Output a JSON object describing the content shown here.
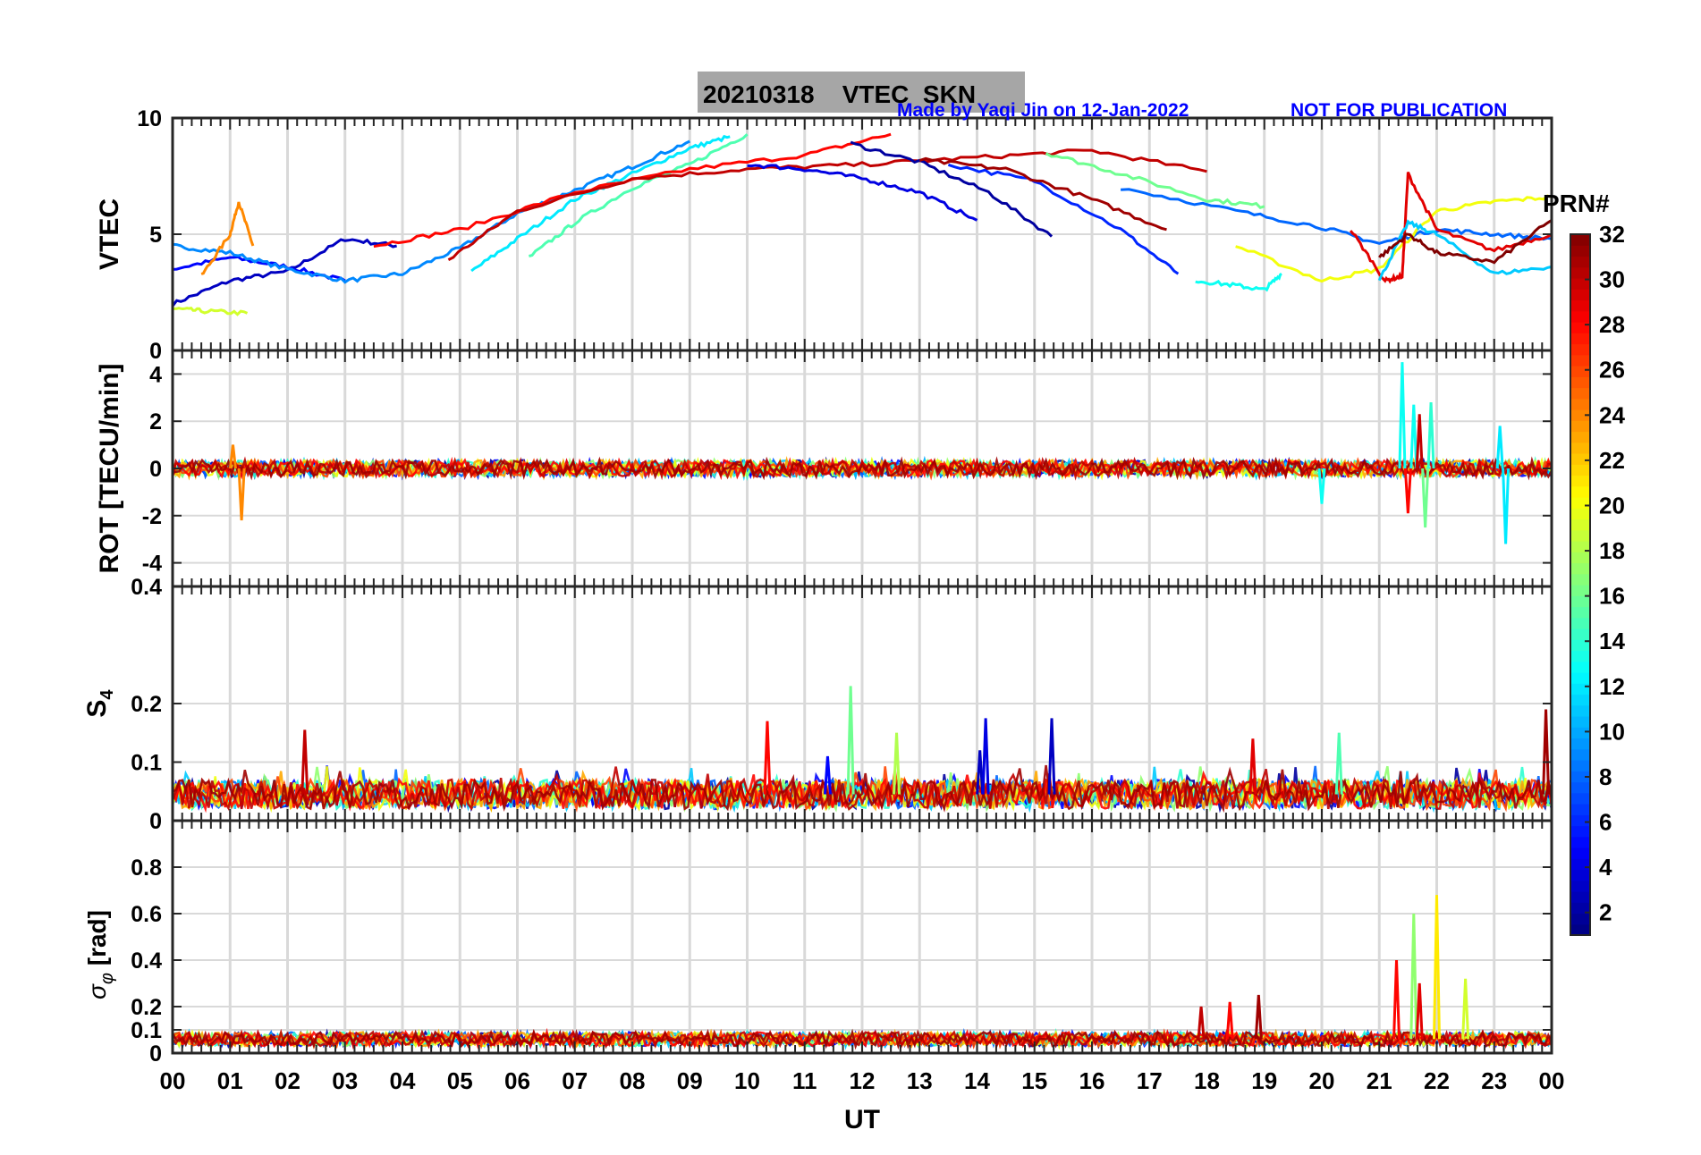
{
  "header": {
    "title": "20210318    VTEC  SKN",
    "credit": "Made by Yaqi Jin on 12-Jan-2022",
    "notice": "NOT FOR PUBLICATION"
  },
  "xaxis": {
    "label": "UT",
    "ticks": [
      "00",
      "01",
      "02",
      "03",
      "04",
      "05",
      "06",
      "07",
      "08",
      "09",
      "10",
      "11",
      "12",
      "13",
      "14",
      "15",
      "16",
      "17",
      "18",
      "19",
      "20",
      "21",
      "22",
      "23",
      "00"
    ],
    "range": [
      0,
      24
    ]
  },
  "colorbar": {
    "title": "PRN#",
    "range": [
      1,
      32
    ],
    "ticks": [
      2,
      4,
      6,
      8,
      10,
      12,
      14,
      16,
      18,
      20,
      22,
      24,
      26,
      28,
      30,
      32
    ],
    "colormap": "jet"
  },
  "chart_data": [
    {
      "type": "line",
      "panel": "vtec",
      "ylabel": "VTEC",
      "ylim": [
        0,
        10
      ],
      "yticks": [
        0,
        5,
        10
      ],
      "grid": true,
      "series": [
        {
          "prn": 3,
          "x": [
            0,
            1,
            2,
            3,
            3.9
          ],
          "y": [
            2.0,
            3.0,
            3.4,
            4.8,
            4.5
          ]
        },
        {
          "prn": 5,
          "x": [
            0,
            1,
            2,
            3
          ],
          "y": [
            3.5,
            4.0,
            3.6,
            3.0
          ]
        },
        {
          "prn": 9,
          "x": [
            0,
            1,
            2,
            3,
            4,
            5,
            6,
            7,
            8,
            9
          ],
          "y": [
            4.5,
            4.2,
            3.5,
            3.0,
            3.3,
            4.4,
            5.9,
            6.9,
            7.9,
            9.0
          ]
        },
        {
          "prn": 24,
          "x": [
            0.5,
            1.0,
            1.15,
            1.4
          ],
          "y": [
            3.2,
            5.0,
            6.4,
            4.5
          ]
        },
        {
          "prn": 19,
          "x": [
            0,
            0.5,
            1.3
          ],
          "y": [
            1.8,
            1.7,
            1.6
          ]
        },
        {
          "prn": 12,
          "x": [
            5.2,
            6.0,
            7.0,
            8.0,
            9.0,
            9.7
          ],
          "y": [
            3.4,
            4.8,
            6.5,
            7.6,
            8.7,
            9.2
          ]
        },
        {
          "prn": 15,
          "x": [
            6.2,
            7.0,
            8.0,
            9.0,
            10.0
          ],
          "y": [
            4.0,
            5.5,
            7.0,
            8.0,
            9.3
          ]
        },
        {
          "prn": 28,
          "x": [
            3.5,
            5,
            7,
            9,
            11,
            12.5
          ],
          "y": [
            4.5,
            5.2,
            6.8,
            7.8,
            8.4,
            9.3
          ]
        },
        {
          "prn": 30,
          "x": [
            4.8,
            6,
            8,
            10,
            12,
            14,
            16,
            18
          ],
          "y": [
            3.9,
            6.0,
            7.4,
            7.8,
            8.0,
            8.3,
            8.6,
            7.7
          ]
        },
        {
          "prn": 4,
          "x": [
            10,
            11,
            12,
            13,
            14.0
          ],
          "y": [
            8.0,
            7.8,
            7.4,
            6.8,
            5.6
          ]
        },
        {
          "prn": 2,
          "x": [
            11.8,
            13,
            14.2,
            15.3
          ],
          "y": [
            8.9,
            8.1,
            6.8,
            4.9
          ]
        },
        {
          "prn": 6,
          "x": [
            13.5,
            15,
            16.5,
            17.5
          ],
          "y": [
            8.0,
            7.3,
            5.2,
            3.3
          ]
        },
        {
          "prn": 31,
          "x": [
            13.0,
            14.5,
            16,
            17.3
          ],
          "y": [
            8.2,
            7.8,
            6.5,
            5.2
          ]
        },
        {
          "prn": 16,
          "x": [
            15.2,
            16.5,
            18,
            19.0
          ],
          "y": [
            8.5,
            7.6,
            6.5,
            6.2
          ]
        },
        {
          "prn": 13,
          "x": [
            17.8,
            18.5,
            19.0,
            19.3
          ],
          "y": [
            3.0,
            2.8,
            2.6,
            3.3
          ]
        },
        {
          "prn": 8,
          "x": [
            16.5,
            18.5,
            20.0,
            21.0,
            22.0,
            23.0,
            24.0
          ],
          "y": [
            7.0,
            6.0,
            5.3,
            4.6,
            5.2,
            5.0,
            4.8
          ]
        },
        {
          "prn": 20,
          "x": [
            18.5,
            20.0,
            21.0,
            22.0,
            23.0,
            24.0
          ],
          "y": [
            4.5,
            3.0,
            3.5,
            6.0,
            6.4,
            6.6
          ]
        },
        {
          "prn": 29,
          "x": [
            20.5,
            21.1,
            21.4,
            21.5,
            22.0,
            23.0,
            24.0
          ],
          "y": [
            5.2,
            3.0,
            3.2,
            7.6,
            5.2,
            4.3,
            5.0
          ]
        },
        {
          "prn": 11,
          "x": [
            21.0,
            21.5,
            22.0,
            23.0,
            24.0
          ],
          "y": [
            3.0,
            5.5,
            5.0,
            3.3,
            3.6
          ]
        },
        {
          "prn": 32,
          "x": [
            21.0,
            21.5,
            22.0,
            23.0,
            24.0
          ],
          "y": [
            4.0,
            5.0,
            4.2,
            3.8,
            5.6
          ]
        }
      ]
    },
    {
      "type": "line",
      "panel": "rot",
      "ylabel": "ROT [TECU/min]",
      "ylim": [
        -5,
        5
      ],
      "yticks": [
        -4,
        -2,
        0,
        2,
        4
      ],
      "grid": true,
      "spikes": [
        {
          "prn": 24,
          "x": 1.05,
          "y": 1.0
        },
        {
          "prn": 24,
          "x": 1.2,
          "y": -2.2
        },
        {
          "prn": 13,
          "x": 21.4,
          "y": 4.5
        },
        {
          "prn": 13,
          "x": 21.6,
          "y": 2.7
        },
        {
          "prn": 28,
          "x": 21.5,
          "y": -1.9
        },
        {
          "prn": 30,
          "x": 21.7,
          "y": 2.3
        },
        {
          "prn": 16,
          "x": 21.8,
          "y": -2.5
        },
        {
          "prn": 14,
          "x": 21.9,
          "y": 2.8
        },
        {
          "prn": 12,
          "x": 23.1,
          "y": 1.8
        },
        {
          "prn": 12,
          "x": 23.2,
          "y": -3.2
        },
        {
          "prn": 13,
          "x": 20.0,
          "y": -1.5
        }
      ]
    },
    {
      "type": "line",
      "panel": "s4",
      "ylabel": "S4",
      "ylim": [
        0,
        0.4
      ],
      "yticks": [
        0,
        0.1,
        0.2,
        0.4
      ],
      "grid": true,
      "spikes": [
        {
          "prn": 30,
          "x": 2.3,
          "y": 0.155
        },
        {
          "prn": 28,
          "x": 10.35,
          "y": 0.17
        },
        {
          "prn": 5,
          "x": 11.4,
          "y": 0.11
        },
        {
          "prn": 16,
          "x": 11.8,
          "y": 0.23
        },
        {
          "prn": 18,
          "x": 12.6,
          "y": 0.15
        },
        {
          "prn": 3,
          "x": 14.05,
          "y": 0.12
        },
        {
          "prn": 4,
          "x": 14.15,
          "y": 0.175
        },
        {
          "prn": 3,
          "x": 15.3,
          "y": 0.175
        },
        {
          "prn": 15,
          "x": 20.3,
          "y": 0.15
        },
        {
          "prn": 29,
          "x": 18.8,
          "y": 0.14
        },
        {
          "prn": 31,
          "x": 23.9,
          "y": 0.19
        }
      ]
    },
    {
      "type": "line",
      "panel": "sigma_phi",
      "ylabel": "σφ [rad]",
      "ylim": [
        0,
        1
      ],
      "yticks": [
        0,
        0.1,
        0.2,
        0.4,
        0.6,
        0.8
      ],
      "grid": true,
      "spikes": [
        {
          "prn": 28,
          "x": 21.3,
          "y": 0.4
        },
        {
          "prn": 17,
          "x": 21.6,
          "y": 0.6
        },
        {
          "prn": 29,
          "x": 21.7,
          "y": 0.3
        },
        {
          "prn": 21,
          "x": 22.0,
          "y": 0.68
        },
        {
          "prn": 19,
          "x": 22.5,
          "y": 0.32
        },
        {
          "prn": 30,
          "x": 17.9,
          "y": 0.2
        },
        {
          "prn": 31,
          "x": 18.9,
          "y": 0.25
        },
        {
          "prn": 28,
          "x": 18.4,
          "y": 0.22
        }
      ]
    }
  ]
}
